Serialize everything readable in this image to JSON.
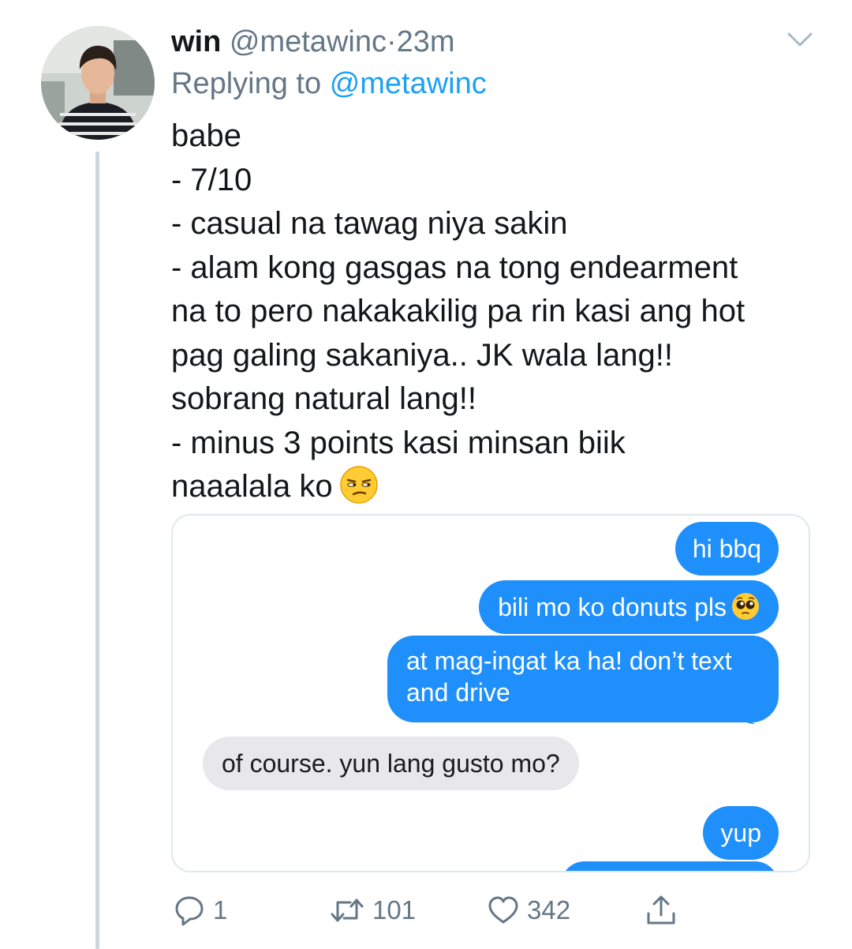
{
  "tweet": {
    "display_name": "win",
    "handle": "@metawinc",
    "separator": "·",
    "time": "23m",
    "replying_prefix": "Replying to",
    "replying_to": "@metawinc",
    "lines": [
      "babe",
      "- 7/10",
      "- casual na tawag niya sakin",
      "- alam kong gasgas na tong endearment",
      "na to pero nakakakilig pa rin kasi ang hot",
      "pag galing sakaniya.. JK wala lang!!",
      "sobrang natural lang!!",
      "- minus 3 points kasi minsan biik",
      "naaalala ko"
    ],
    "trailing_emoji": "unamused-face-emoji"
  },
  "chat": {
    "messages": [
      {
        "from": "me",
        "text": "hi bbq"
      },
      {
        "from": "me",
        "text": "bili mo ko donuts pls",
        "emoji": "pleading-face-emoji"
      },
      {
        "from": "me",
        "text": "at mag-ingat ka ha! don’t text and drive"
      },
      {
        "from": "them",
        "text": "of course. yun lang gusto mo?"
      },
      {
        "from": "me",
        "text": "yup"
      }
    ],
    "colors": {
      "sent": "#1f8ffb",
      "received": "#e7e7ec"
    }
  },
  "actions": {
    "reply_count": "1",
    "retweet_count": "101",
    "like_count": "342",
    "icons": [
      "reply-icon",
      "retweet-icon",
      "like-icon",
      "share-icon"
    ]
  },
  "colors": {
    "accent": "#1da1f2",
    "muted": "#657786",
    "thread_line": "#ccd6dd"
  }
}
